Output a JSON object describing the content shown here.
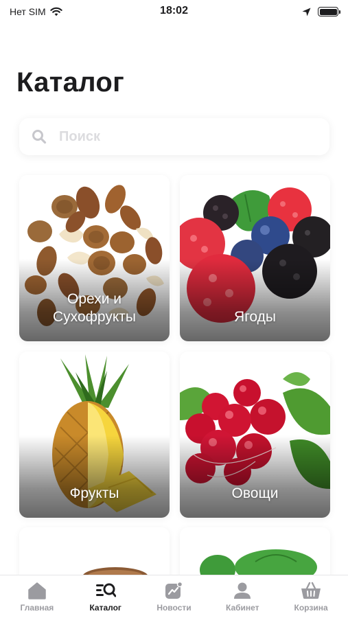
{
  "status_bar": {
    "carrier": "Нет SIM",
    "time": "18:02"
  },
  "page": {
    "title": "Каталог"
  },
  "search": {
    "placeholder": "Поиск",
    "value": ""
  },
  "categories": [
    {
      "label": "Орехи и\nСухофрукты",
      "image": "nuts-image"
    },
    {
      "label": "Ягоды",
      "image": "berries-image"
    },
    {
      "label": "Фрукты",
      "image": "pineapple-image"
    },
    {
      "label": "Овощи",
      "image": "radish-image"
    }
  ],
  "partial_cards": [
    {
      "image": "bread-image"
    },
    {
      "image": "greens-image"
    }
  ],
  "tab_bar": {
    "active": "Каталог",
    "tabs": [
      {
        "label": "Главная",
        "icon": "home-icon"
      },
      {
        "label": "Каталог",
        "icon": "catalog-search-icon"
      },
      {
        "label": "Новости",
        "icon": "news-chart-icon"
      },
      {
        "label": "Кабинет",
        "icon": "user-icon"
      },
      {
        "label": "Корзина",
        "icon": "basket-icon"
      }
    ]
  },
  "colors": {
    "text": "#1c1c1e",
    "muted": "#9b9ba0",
    "placeholder": "#dcdcdf",
    "background": "#ffffff"
  }
}
